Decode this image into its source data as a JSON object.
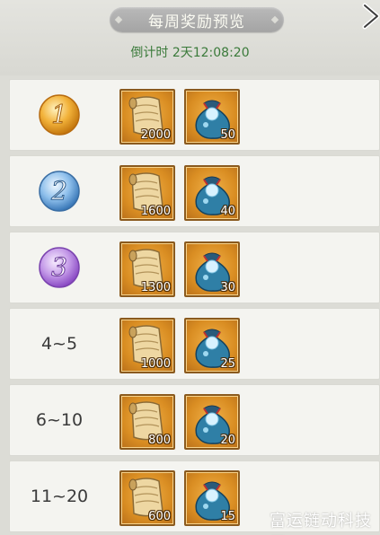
{
  "header": {
    "title": "每周奖励预览",
    "countdown": "倒计时 2天12:08:20"
  },
  "rows": [
    {
      "rank": "1",
      "rank_style": "gold",
      "scroll_qty": "2000",
      "bag_qty": "50"
    },
    {
      "rank": "2",
      "rank_style": "blue",
      "scroll_qty": "1600",
      "bag_qty": "40"
    },
    {
      "rank": "3",
      "rank_style": "purple",
      "scroll_qty": "1300",
      "bag_qty": "30"
    },
    {
      "rank": "4~5",
      "rank_style": "text",
      "scroll_qty": "1000",
      "bag_qty": "25"
    },
    {
      "rank": "6~10",
      "rank_style": "text",
      "scroll_qty": "800",
      "bag_qty": "20"
    },
    {
      "rank": "11~20",
      "rank_style": "text",
      "scroll_qty": "600",
      "bag_qty": "15"
    }
  ],
  "icons": {
    "close": "close-icon",
    "scroll": "scroll-icon",
    "bag": "gem-bag-icon"
  },
  "colors": {
    "countdown": "#3a7a3a",
    "item_frame": "#d98d22",
    "gold_medal": "#e8a020",
    "blue_medal": "#4a8fd0",
    "purple_medal": "#9a5ad0"
  },
  "watermark": "富运链动科技网"
}
